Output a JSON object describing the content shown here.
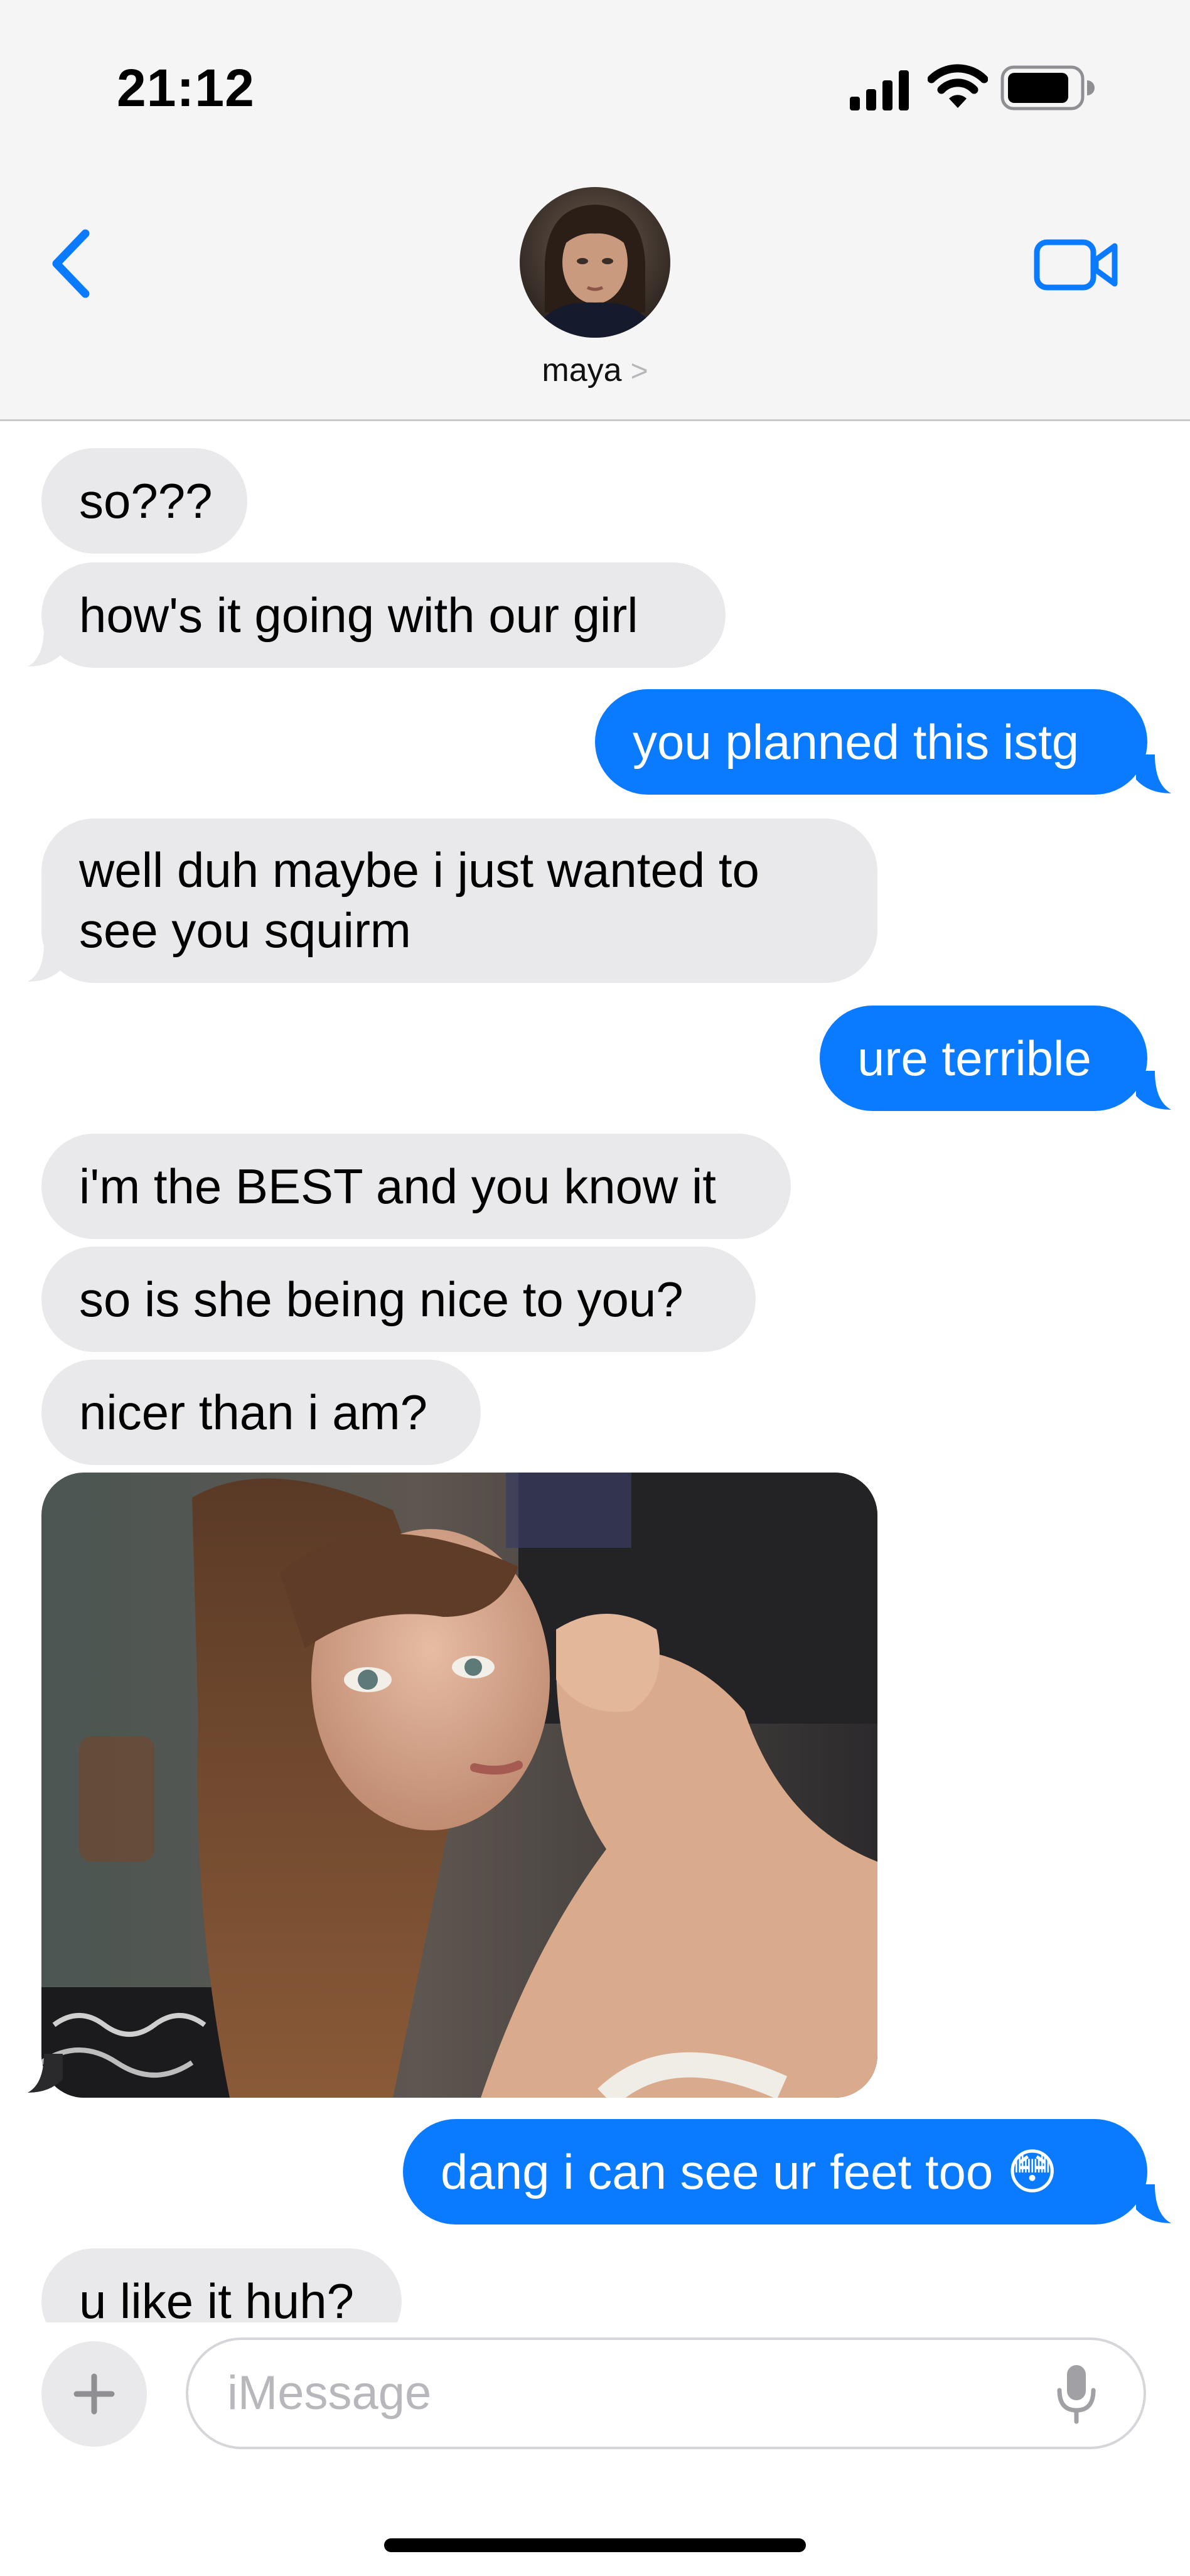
{
  "status_bar": {
    "time": "21:12"
  },
  "header": {
    "contact_name": "maya",
    "contact_chevron": ">"
  },
  "messages": [
    {
      "from": "them",
      "text": "so???"
    },
    {
      "from": "them",
      "text": "how's it going with our girl"
    },
    {
      "from": "me",
      "text": "you planned this istg"
    },
    {
      "from": "them",
      "text": "well duh maybe i just wanted to see you squirm"
    },
    {
      "from": "me",
      "text": "ure terrible"
    },
    {
      "from": "them",
      "text": "i'm the BEST and you know it"
    },
    {
      "from": "them",
      "text": "so is she being nice to you?"
    },
    {
      "from": "them",
      "text": "nicer than i am?"
    },
    {
      "from": "them",
      "type": "photo"
    },
    {
      "from": "me",
      "text": "dang i can see ur feet too 😳"
    },
    {
      "from": "them",
      "text": "u like it huh?"
    }
  ],
  "composer": {
    "placeholder": "iMessage"
  },
  "colors": {
    "accent": "#0a7aff",
    "received_bubble": "#e9e9eb",
    "header_bg": "#f5f5f5"
  }
}
